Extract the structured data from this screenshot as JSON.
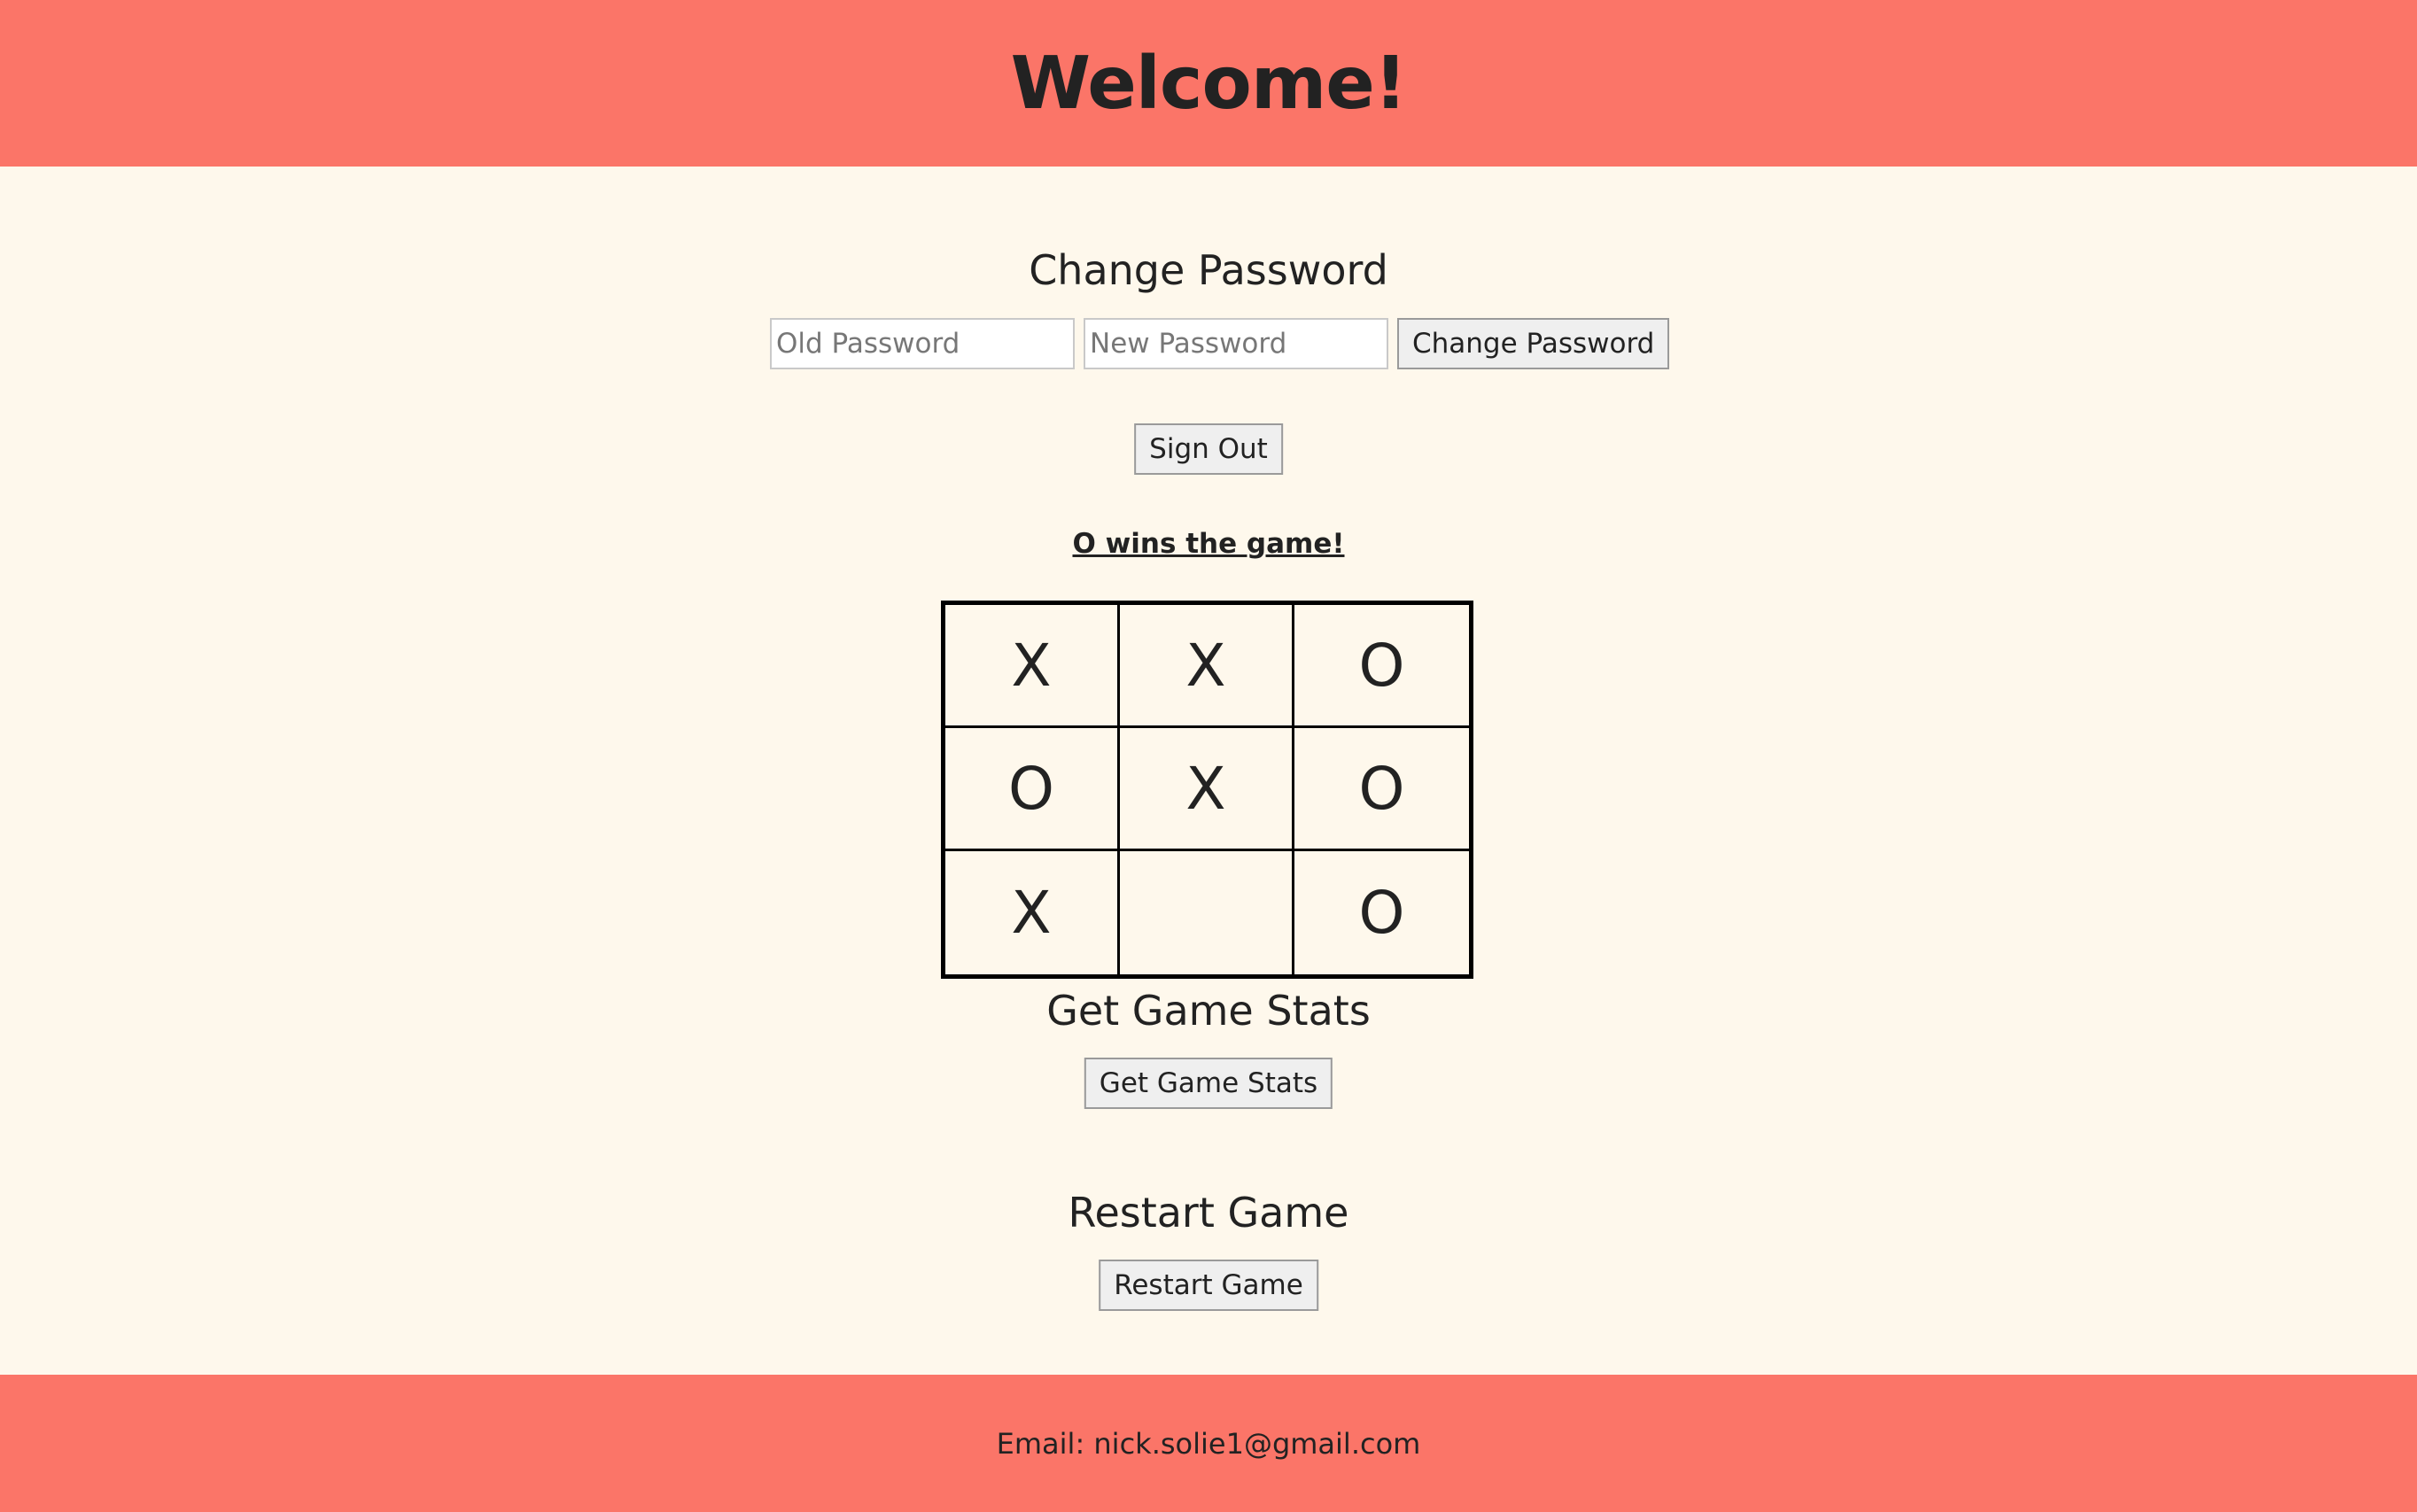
{
  "header": {
    "title": "Welcome!"
  },
  "change_password": {
    "heading": "Change Password",
    "old_placeholder": "Old Password",
    "new_placeholder": "New Password",
    "old_value": "",
    "new_value": "",
    "submit_label": "Change Password"
  },
  "sign_out": {
    "label": "Sign Out"
  },
  "game": {
    "status": "O wins the game!",
    "board": [
      [
        "X",
        "X",
        "O"
      ],
      [
        "O",
        "X",
        "O"
      ],
      [
        "X",
        "",
        "O"
      ]
    ]
  },
  "stats": {
    "heading": "Get Game Stats",
    "button_label": "Get Game Stats"
  },
  "restart": {
    "heading": "Restart Game",
    "button_label": "Restart Game"
  },
  "footer": {
    "email_text": "Email: nick.solie1@gmail.com"
  },
  "colors": {
    "header_bg": "#fb7568",
    "page_bg": "#fef8ec",
    "text": "#222222"
  }
}
